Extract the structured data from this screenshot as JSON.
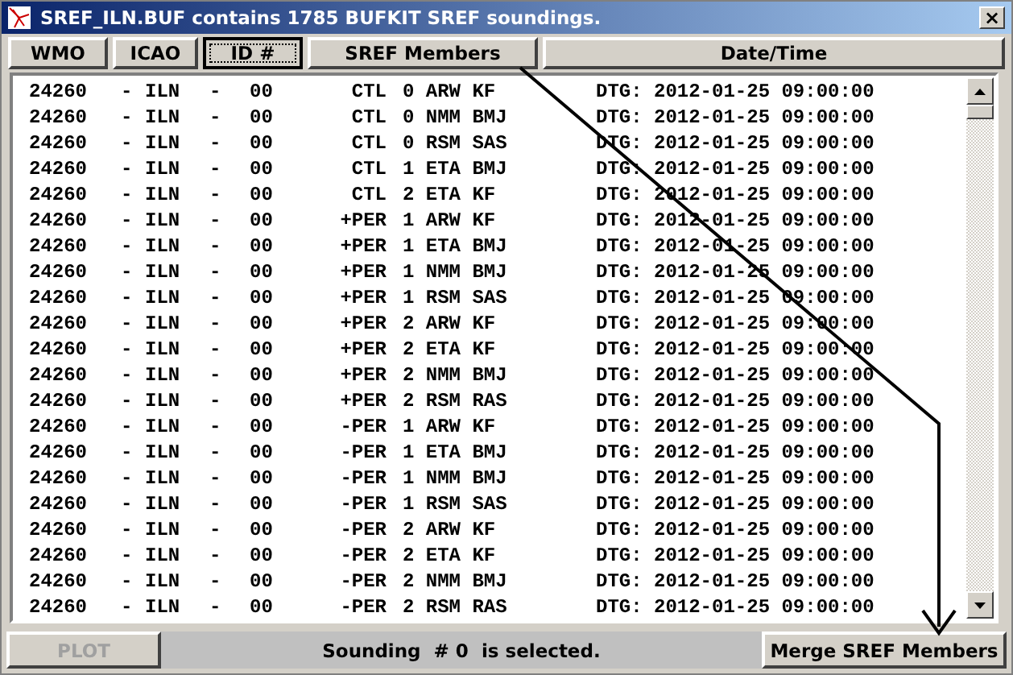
{
  "window": {
    "title": "SREF_ILN.BUF contains 1785 BUFKIT SREF soundings.",
    "close": "×"
  },
  "columns": [
    {
      "label": "WMO",
      "selected": false
    },
    {
      "label": "ICAO",
      "selected": false
    },
    {
      "label": "ID #",
      "selected": true
    },
    {
      "label": "SREF Members",
      "selected": false
    },
    {
      "label": "Date/Time",
      "selected": false
    }
  ],
  "rows": [
    {
      "wmo": "24260",
      "sep1": "-",
      "icao": "ILN",
      "sep2": "-",
      "id": "00",
      "type": "CTL",
      "member": "0 ARW KF",
      "datetime": "DTG: 2012-01-25 09:00:00"
    },
    {
      "wmo": "24260",
      "sep1": "-",
      "icao": "ILN",
      "sep2": "-",
      "id": "00",
      "type": "CTL",
      "member": "0 NMM BMJ",
      "datetime": "DTG: 2012-01-25 09:00:00"
    },
    {
      "wmo": "24260",
      "sep1": "-",
      "icao": "ILN",
      "sep2": "-",
      "id": "00",
      "type": "CTL",
      "member": "0 RSM SAS",
      "datetime": "DTG: 2012-01-25 09:00:00"
    },
    {
      "wmo": "24260",
      "sep1": "-",
      "icao": "ILN",
      "sep2": "-",
      "id": "00",
      "type": "CTL",
      "member": "1 ETA BMJ",
      "datetime": "DTG: 2012-01-25 09:00:00"
    },
    {
      "wmo": "24260",
      "sep1": "-",
      "icao": "ILN",
      "sep2": "-",
      "id": "00",
      "type": "CTL",
      "member": "2 ETA KF",
      "datetime": "DTG: 2012-01-25 09:00:00"
    },
    {
      "wmo": "24260",
      "sep1": "-",
      "icao": "ILN",
      "sep2": "-",
      "id": "00",
      "type": "+PER",
      "member": "1 ARW KF",
      "datetime": "DTG: 2012-01-25 09:00:00"
    },
    {
      "wmo": "24260",
      "sep1": "-",
      "icao": "ILN",
      "sep2": "-",
      "id": "00",
      "type": "+PER",
      "member": "1 ETA BMJ",
      "datetime": "DTG: 2012-01-25 09:00:00"
    },
    {
      "wmo": "24260",
      "sep1": "-",
      "icao": "ILN",
      "sep2": "-",
      "id": "00",
      "type": "+PER",
      "member": "1 NMM BMJ",
      "datetime": "DTG: 2012-01-25 09:00:00"
    },
    {
      "wmo": "24260",
      "sep1": "-",
      "icao": "ILN",
      "sep2": "-",
      "id": "00",
      "type": "+PER",
      "member": "1 RSM SAS",
      "datetime": "DTG: 2012-01-25 09:00:00"
    },
    {
      "wmo": "24260",
      "sep1": "-",
      "icao": "ILN",
      "sep2": "-",
      "id": "00",
      "type": "+PER",
      "member": "2 ARW KF",
      "datetime": "DTG: 2012-01-25 09:00:00"
    },
    {
      "wmo": "24260",
      "sep1": "-",
      "icao": "ILN",
      "sep2": "-",
      "id": "00",
      "type": "+PER",
      "member": "2 ETA KF",
      "datetime": "DTG: 2012-01-25 09:00:00"
    },
    {
      "wmo": "24260",
      "sep1": "-",
      "icao": "ILN",
      "sep2": "-",
      "id": "00",
      "type": "+PER",
      "member": "2 NMM BMJ",
      "datetime": "DTG: 2012-01-25 09:00:00"
    },
    {
      "wmo": "24260",
      "sep1": "-",
      "icao": "ILN",
      "sep2": "-",
      "id": "00",
      "type": "+PER",
      "member": "2 RSM RAS",
      "datetime": "DTG: 2012-01-25 09:00:00"
    },
    {
      "wmo": "24260",
      "sep1": "-",
      "icao": "ILN",
      "sep2": "-",
      "id": "00",
      "type": "-PER",
      "member": "1 ARW KF",
      "datetime": "DTG: 2012-01-25 09:00:00"
    },
    {
      "wmo": "24260",
      "sep1": "-",
      "icao": "ILN",
      "sep2": "-",
      "id": "00",
      "type": "-PER",
      "member": "1 ETA BMJ",
      "datetime": "DTG: 2012-01-25 09:00:00"
    },
    {
      "wmo": "24260",
      "sep1": "-",
      "icao": "ILN",
      "sep2": "-",
      "id": "00",
      "type": "-PER",
      "member": "1 NMM BMJ",
      "datetime": "DTG: 2012-01-25 09:00:00"
    },
    {
      "wmo": "24260",
      "sep1": "-",
      "icao": "ILN",
      "sep2": "-",
      "id": "00",
      "type": "-PER",
      "member": "1 RSM SAS",
      "datetime": "DTG: 2012-01-25 09:00:00"
    },
    {
      "wmo": "24260",
      "sep1": "-",
      "icao": "ILN",
      "sep2": "-",
      "id": "00",
      "type": "-PER",
      "member": "2 ARW KF",
      "datetime": "DTG: 2012-01-25 09:00:00"
    },
    {
      "wmo": "24260",
      "sep1": "-",
      "icao": "ILN",
      "sep2": "-",
      "id": "00",
      "type": "-PER",
      "member": "2 ETA KF",
      "datetime": "DTG: 2012-01-25 09:00:00"
    },
    {
      "wmo": "24260",
      "sep1": "-",
      "icao": "ILN",
      "sep2": "-",
      "id": "00",
      "type": "-PER",
      "member": "2 NMM BMJ",
      "datetime": "DTG: 2012-01-25 09:00:00"
    },
    {
      "wmo": "24260",
      "sep1": "-",
      "icao": "ILN",
      "sep2": "-",
      "id": "00",
      "type": "-PER",
      "member": "2 RSM RAS",
      "datetime": "DTG: 2012-01-25 09:00:00"
    }
  ],
  "plot_button": {
    "label": "PLOT",
    "disabled": true
  },
  "status": "Sounding  # 0  is selected.",
  "merge_button": {
    "label": "Merge SREF Members",
    "disabled": false
  }
}
